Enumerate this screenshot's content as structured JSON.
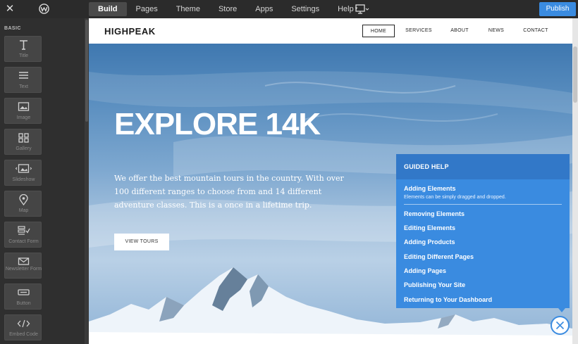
{
  "topbar": {
    "close_glyph": "✕",
    "tabs": [
      "Build",
      "Pages",
      "Theme",
      "Store",
      "Apps",
      "Settings",
      "Help"
    ],
    "help_caret": "▾",
    "publish_label": "Publish",
    "icons": [
      "close-icon",
      "weebly-logo-icon",
      "desktop-icon",
      "chevron-down-icon"
    ]
  },
  "sidebar": {
    "section_label": "BASIC",
    "elements": [
      {
        "label": "Title",
        "icon": "title-icon"
      },
      {
        "label": "Text",
        "icon": "text-icon"
      },
      {
        "label": "Image",
        "icon": "image-icon"
      },
      {
        "label": "Gallery",
        "icon": "gallery-icon"
      },
      {
        "label": "Slideshow",
        "icon": "slideshow-icon"
      },
      {
        "label": "Map",
        "icon": "map-pin-icon"
      },
      {
        "label": "Contact Form",
        "icon": "contact-form-icon"
      },
      {
        "label": "Newsletter Form",
        "icon": "envelope-icon"
      },
      {
        "label": "Button",
        "icon": "button-icon"
      },
      {
        "label": "Embed Code",
        "icon": "code-icon"
      }
    ]
  },
  "site": {
    "brand": "HIGHPEAK",
    "nav": [
      "HOME",
      "SERVICES",
      "ABOUT",
      "NEWS",
      "CONTACT"
    ],
    "hero_title": "EXPLORE 14K",
    "hero_body": "We offer the best mountain tours in the country. With over 100 different ranges to choose from and 14 different adventure classes. This is a once in a lifetime trip.",
    "hero_button": "VIEW TOURS"
  },
  "guided_help": {
    "title": "GUIDED HELP",
    "first_item": "Adding Elements",
    "first_item_desc": "Elements can be simply dragged and dropped.",
    "items": [
      "Removing Elements",
      "Editing Elements",
      "Adding Products",
      "Editing Different Pages",
      "Adding Pages",
      "Publishing Your Site",
      "Returning to Your Dashboard"
    ],
    "close_icon": "close-circle-icon"
  },
  "colors": {
    "accent": "#3a8be0",
    "toolbar_bg": "#2b2b2b",
    "sidebar_bg": "#2f2f2f",
    "help_header": "#3278c8"
  }
}
